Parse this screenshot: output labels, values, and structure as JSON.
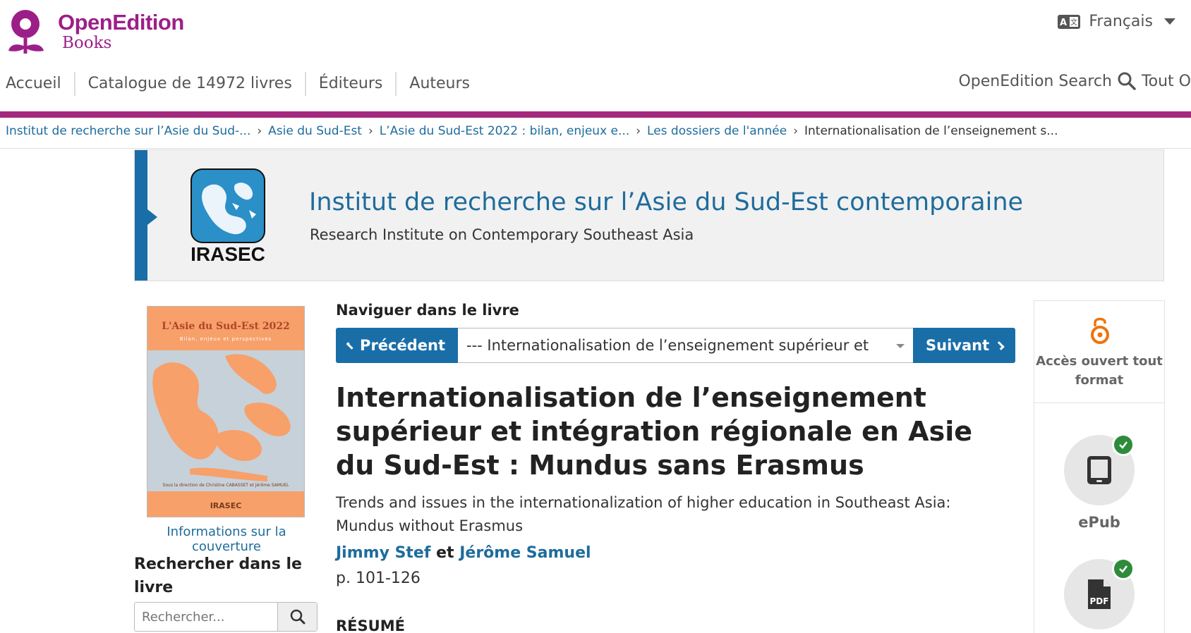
{
  "header": {
    "logo_brand": "OpenEdition",
    "logo_sub": "Books",
    "language": "Français"
  },
  "nav": {
    "items": [
      {
        "label": "Accueil"
      },
      {
        "label": "Catalogue de 14972 livres"
      },
      {
        "label": "Éditeurs"
      },
      {
        "label": "Auteurs"
      }
    ],
    "search_label": "OpenEdition Search",
    "search_scope": "Tout O"
  },
  "colors": {
    "brand": "#9c1f88",
    "accent_bar": "#a4287e",
    "link": "#1e6c9c",
    "button": "#1a6ea8",
    "check": "#2e8b3a"
  },
  "breadcrumb": [
    {
      "label": "Institut de recherche sur l’Asie du Sud-..."
    },
    {
      "label": "Asie du Sud-Est"
    },
    {
      "label": "L’Asie du Sud-Est 2022 : bilan, enjeux e..."
    },
    {
      "label": "Les dossiers de l'année"
    },
    {
      "label": "Internationalisation de l’enseignement s..."
    }
  ],
  "publisher": {
    "logo_text": "IRASEC",
    "name": "Institut de recherche sur l’Asie du Sud-Est contemporaine",
    "subtitle": "Research Institute on Contemporary Southeast Asia"
  },
  "cover": {
    "title": "L'Asie du Sud-Est 2022",
    "subtitle": "Bilan, enjeux et perspectives",
    "direction": "Sous la direction de Christine CABASSET et Jérôme SAMUEL",
    "publisher": "IRASEC",
    "info_link": "Informations sur la couverture"
  },
  "book_search": {
    "title": "Rechercher dans le livre",
    "placeholder": "Rechercher..."
  },
  "book_nav": {
    "title": "Naviguer dans le livre",
    "prev_label": "Précédent",
    "next_label": "Suivant",
    "selected_chapter": "--- Internationalisation de l’enseignement supérieur et"
  },
  "article": {
    "title": "Internationalisation de l’enseignement supérieur et intégration régionale en Asie du Sud-Est : Mundus sans Erasmus",
    "translation": "Trends and issues in the internationalization of higher education in Southeast Asia: Mundus without Erasmus",
    "authors": [
      {
        "name": "Jimmy Stef"
      },
      {
        "name": "Jérôme Samuel"
      }
    ],
    "author_conjunction": "et",
    "pages": "p. 101-126",
    "section_heading": "RÉSUMÉ"
  },
  "access": {
    "open_access_label": "Accès ouvert tout format",
    "formats": [
      {
        "label": "ePub",
        "icon": "tablet-icon",
        "available": true
      },
      {
        "label": "PDF",
        "icon": "pdf-file-icon",
        "available": true
      }
    ]
  }
}
